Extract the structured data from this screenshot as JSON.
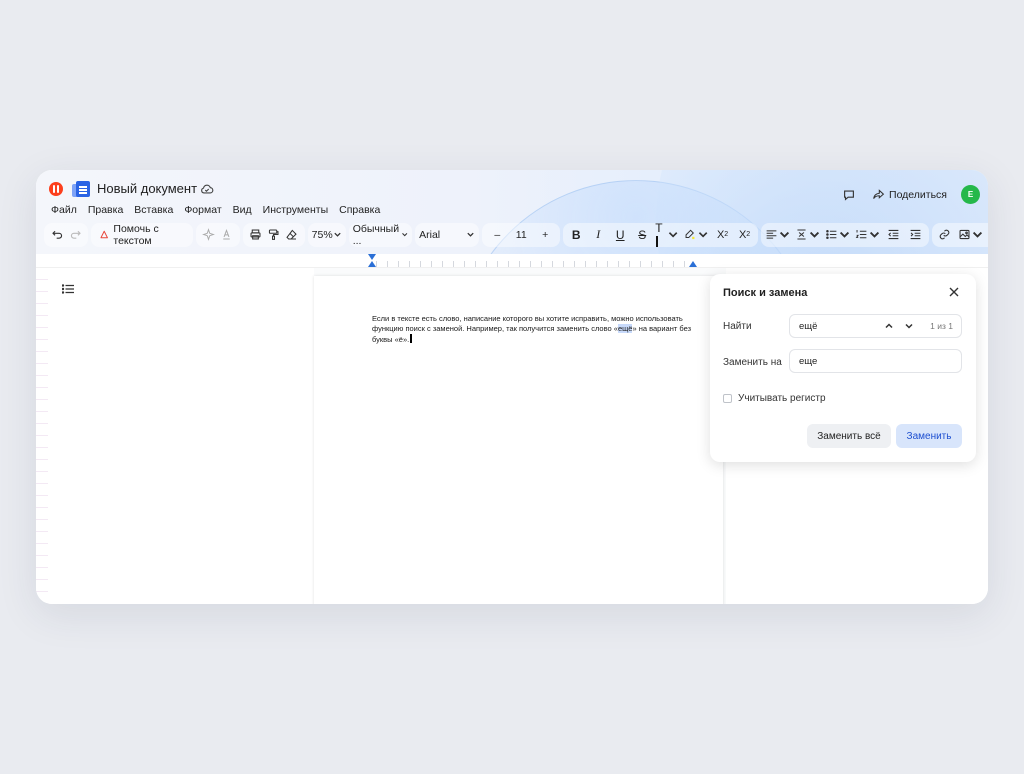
{
  "app": {
    "document_title": "Новый документ",
    "menu": [
      "Файл",
      "Правка",
      "Вставка",
      "Формат",
      "Вид",
      "Инструменты",
      "Справка"
    ],
    "share_label": "Поделиться",
    "avatar_initial": "Е"
  },
  "toolbar": {
    "help_label": "Помочь с текстом",
    "zoom": "75%",
    "style": "Обычный ...",
    "font": "Arial",
    "font_size": "11",
    "minus": "–",
    "plus": "+"
  },
  "document": {
    "text_before": "Если в тексте есть слово, написание которого вы хотите исправить, можно использовать функцию поиск с заменой. Например, так получится заменить слово «",
    "highlight": "ещё",
    "text_after": "» на вариант без буквы «ё»."
  },
  "find_replace": {
    "title": "Поиск и замена",
    "find_label": "Найти",
    "find_value": "ещё",
    "match_count": "1 из 1",
    "replace_label": "Заменить на",
    "replace_value": "еще",
    "case_label": "Учитывать регистр",
    "replace_all_label": "Заменить всё",
    "replace_label_btn": "Заменить"
  },
  "colors": {
    "accent": "#2a63e4",
    "avatar": "#25b84a",
    "logo": "#fc3f1d"
  }
}
